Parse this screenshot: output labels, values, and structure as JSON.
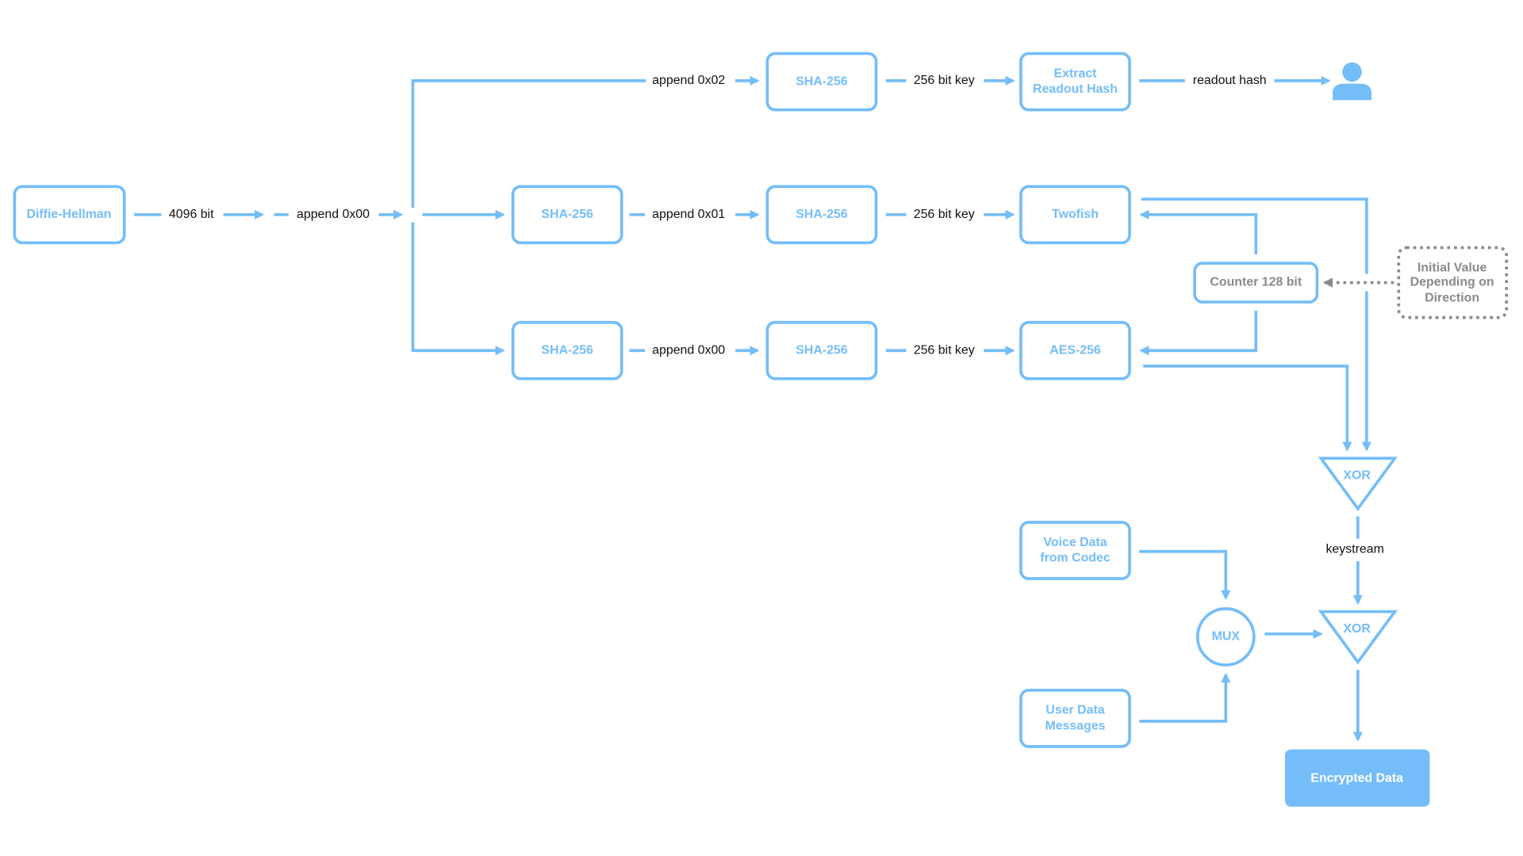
{
  "colors": {
    "accent": "#74bdf9",
    "muted": "#8a8a8a",
    "label": "#111111",
    "filled_node": "#74bdf9"
  },
  "nodes": {
    "diffie_hellman": "Diffie-Hellman",
    "sha_top": "SHA-256",
    "extract": [
      "Extract",
      "Readout Hash"
    ],
    "sha_mid_1": "SHA-256",
    "sha_mid_2": "SHA-256",
    "twofish": "Twofish",
    "sha_bot_1": "SHA-256",
    "sha_bot_2": "SHA-256",
    "aes": "AES-256",
    "counter": "Counter 128 bit",
    "initial_value": [
      "Initial Value",
      "Depending on",
      "Direction"
    ],
    "xor_1": "XOR",
    "xor_2": "XOR",
    "voice": [
      "Voice Data",
      "from Codec"
    ],
    "user": [
      "User Data",
      "Messages"
    ],
    "mux": "MUX",
    "encrypted": "Encrypted Data",
    "user_icon": "person-icon"
  },
  "edges": {
    "dh_bits": "4096 bit",
    "append_main": "append 0x00",
    "append_top": "append 0x02",
    "key_top": "256 bit key",
    "readout": "readout hash",
    "append_mid": "append 0x01",
    "key_mid": "256 bit key",
    "append_bot": "append 0x00",
    "key_bot": "256 bit key",
    "keystream": "keystream"
  }
}
